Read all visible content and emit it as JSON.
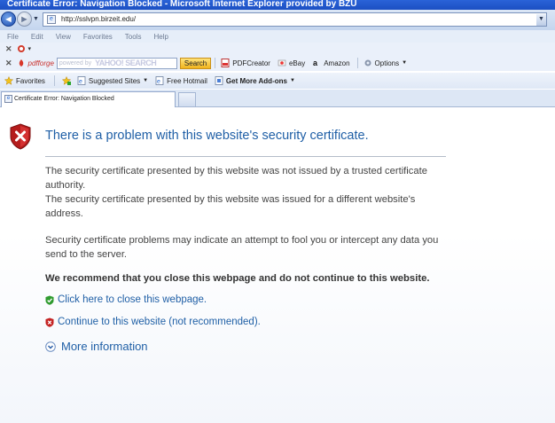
{
  "window": {
    "title": "Certificate Error: Navigation Blocked - Microsoft Internet Explorer provided by BZU"
  },
  "address_bar": {
    "url": "http://sslvpn.birzeit.edu/"
  },
  "menu": {
    "items": [
      "File",
      "Edit",
      "View",
      "Favorites",
      "Tools",
      "Help"
    ]
  },
  "toolbar_pdfforge": {
    "brand": "pdfforge",
    "search_placeholder": "powered by",
    "search_brand": "YAHOO! SEARCH",
    "search_button": "Search",
    "pdfcreator": "PDFCreator",
    "ebay": "eBay",
    "amazon": "Amazon",
    "options": "Options"
  },
  "favorites_bar": {
    "favorites": "Favorites",
    "suggested_sites": "Suggested Sites",
    "free_hotmail": "Free Hotmail",
    "get_more_addons": "Get More Add-ons"
  },
  "tab": {
    "label": "Certificate Error: Navigation Blocked"
  },
  "page": {
    "heading": "There is a problem with this website's security certificate.",
    "reason1": "The security certificate presented by this website was not issued by a trusted certificate authority.",
    "reason2": "The security certificate presented by this website was issued for a different website's address.",
    "warning": "Security certificate problems may indicate an attempt to fool you or intercept any data you send to the server.",
    "recommend": "We recommend that you close this webpage and do not continue to this website.",
    "close_link": "Click here to close this webpage.",
    "continue_link": "Continue to this website (not recommended).",
    "more_info": "More information"
  }
}
